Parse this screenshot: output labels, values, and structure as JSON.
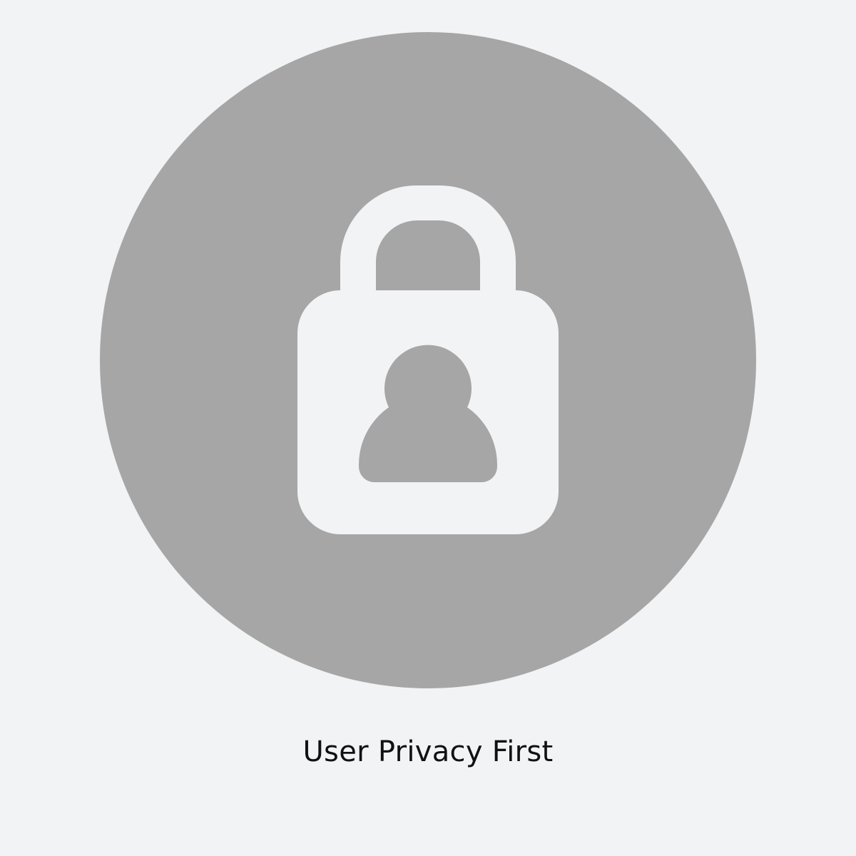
{
  "caption": "User Privacy First",
  "icon": "user-privacy-lock-icon",
  "colors": {
    "background": "#f2f3f5",
    "circle": "#a6a6a6",
    "lock": "#f2f3f5",
    "caption_text": "#111111"
  }
}
